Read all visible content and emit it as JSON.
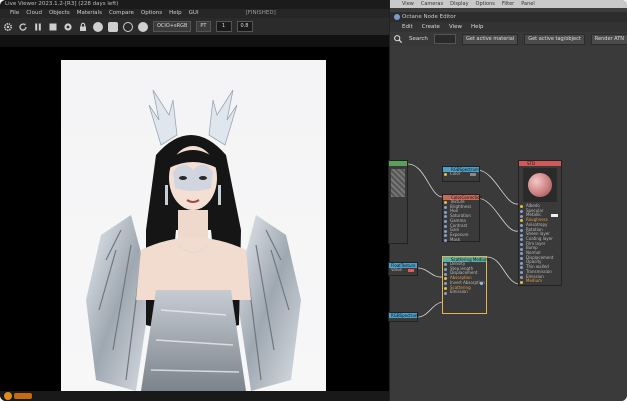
{
  "live_viewer": {
    "title": "Live Viewer 2023.1.2-[R3] (228 days left)",
    "menu": [
      "File",
      "Cloud",
      "Objects",
      "Materials",
      "Compare",
      "Options",
      "Help",
      "GUI"
    ],
    "status": "[FINISHED]",
    "camera_select": "OCIO+sRGB",
    "mode_select": "PT",
    "field_a": "1",
    "field_b": "0.8"
  },
  "node_editor": {
    "top_menu": [
      "View",
      "Cameras",
      "Display",
      "Options",
      "Filter",
      "Panel"
    ],
    "title": "Octane Node Editor",
    "menu": [
      "Edit",
      "Create",
      "View",
      "Help"
    ],
    "search_label": "Search",
    "buttons": [
      "Get active material",
      "Get active tag/object",
      "Render ATN"
    ],
    "nodes": {
      "rgb_spectrum": {
        "title": "RGBSpectrum",
        "rows": [
          "Color"
        ]
      },
      "color_correction": {
        "title": "ColorCorrection",
        "rows": [
          "Texture",
          "Brightness",
          "Hue",
          "Saturation",
          "Gamma",
          "Contrast",
          "Gain",
          "Exposure",
          "Mask"
        ]
      },
      "std": {
        "title": "STD",
        "rows": [
          "Albedo",
          "Specular",
          "Metallic",
          "Roughness",
          "Anisotropy",
          "Rotation",
          "Sheen layer",
          "Coating layer",
          "Film layer",
          "Bump",
          "Normal",
          "Displacement",
          "Opacity",
          "Thin walled",
          "Transmission",
          "Emission",
          "Medium"
        ]
      },
      "scattering": {
        "title": "Scattering Medium",
        "rows": [
          "Density",
          "Step length",
          "Displacement",
          "Absorption",
          "Invert Absorption",
          "Scattering",
          "Emission"
        ]
      },
      "float_texture": {
        "title": "FloatTexture",
        "rows": [
          "Value"
        ]
      },
      "rgb_spectrum_2": {
        "title": "RGBSpectrum",
        "rows": [
          "Color"
        ]
      }
    }
  }
}
